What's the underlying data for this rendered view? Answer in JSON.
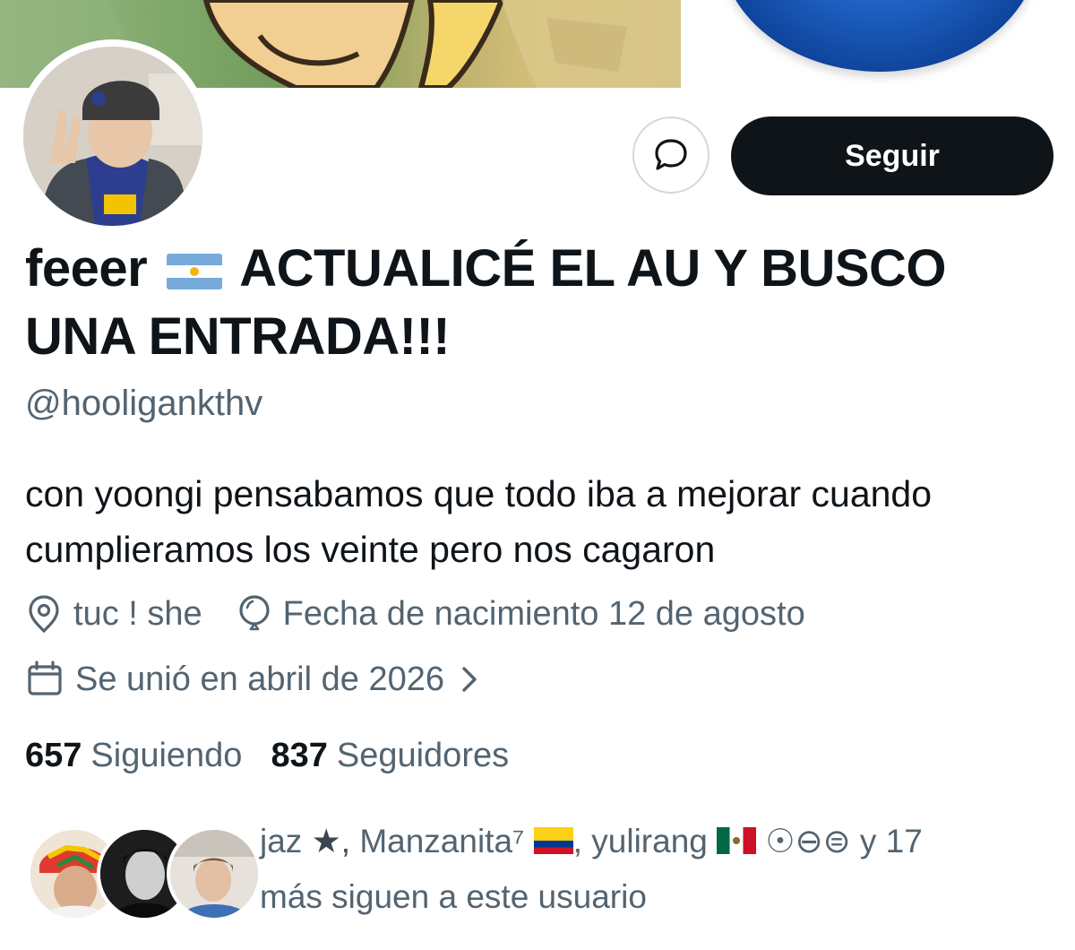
{
  "profile": {
    "display_name_part1": "feeer",
    "display_name_part2": "ACTUALICÉ EL AU Y BUSCO UNA ENTRADA!!!",
    "handle": "@hooligankthv",
    "bio": "con yoongi pensabamos que todo iba a mejorar cuando cumplieramos los veinte pero nos cagaron",
    "location": "tuc ! she",
    "birthday": "Fecha de nacimiento 12 de agosto",
    "joined": "Se unió en abril de 2026",
    "flag_icon": "argentina-flag-icon"
  },
  "actions": {
    "follow_label": "Seguir",
    "message_icon": "message-icon"
  },
  "stats": {
    "following_count": "657",
    "following_label": "Siguiendo",
    "followers_count": "837",
    "followers_label": "Seguidores"
  },
  "known_followers": {
    "name1": "jaz",
    "name1_suffix": "★,",
    "name2": "Manzanita⁷",
    "name3": ", yulirang",
    "symbols": "☉⊖⊜",
    "more": "y 17",
    "tail": "más siguen a este usuario"
  },
  "colors": {
    "text_primary": "#0f1419",
    "text_secondary": "#536471",
    "button_dark": "#0f1419",
    "border": "#cfd9de"
  }
}
